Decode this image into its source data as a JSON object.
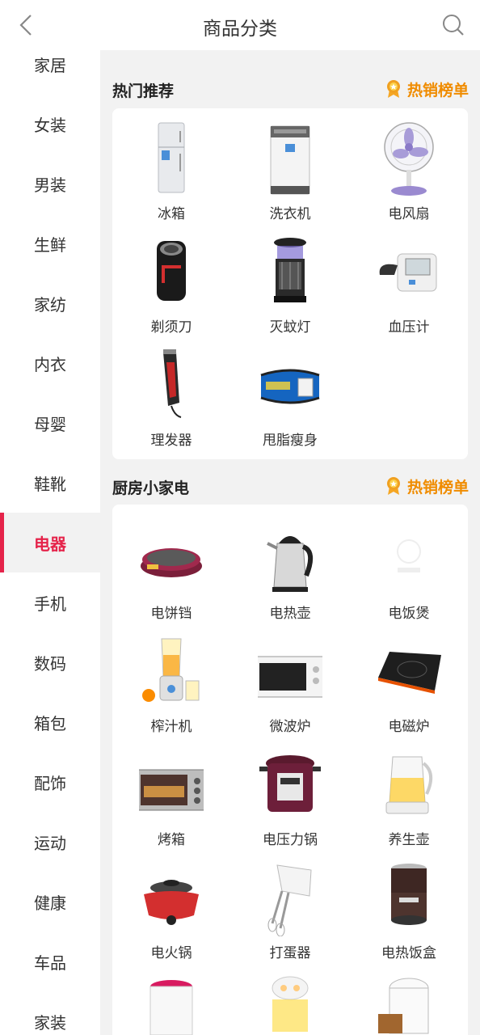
{
  "header": {
    "title": "商品分类"
  },
  "sidebar": {
    "items": [
      "家居",
      "女装",
      "男装",
      "生鲜",
      "家纺",
      "内衣",
      "母婴",
      "鞋靴",
      "电器",
      "手机",
      "数码",
      "箱包",
      "配饰",
      "运动",
      "健康",
      "车品",
      "家装"
    ],
    "active": "电器"
  },
  "sections": [
    {
      "title": "热门推荐",
      "link": "热销榜单",
      "products": [
        "冰箱",
        "洗衣机",
        "电风扇",
        "剃须刀",
        "灭蚊灯",
        "血压计",
        "理发器",
        "甩脂瘦身"
      ]
    },
    {
      "title": "厨房小家电",
      "link": "热销榜单",
      "products": [
        "电饼铛",
        "电热壶",
        "电饭煲",
        "榨汁机",
        "微波炉",
        "电磁炉",
        "烤箱",
        "电压力锅",
        "养生壶",
        "电火锅",
        "打蛋器",
        "电热饭盒"
      ]
    }
  ],
  "colors": {
    "accent": "#e5234a",
    "hot": "#f08c00"
  },
  "icons": {
    "back": "back-arrow-icon",
    "search": "search-icon",
    "medal": "medal-icon"
  }
}
